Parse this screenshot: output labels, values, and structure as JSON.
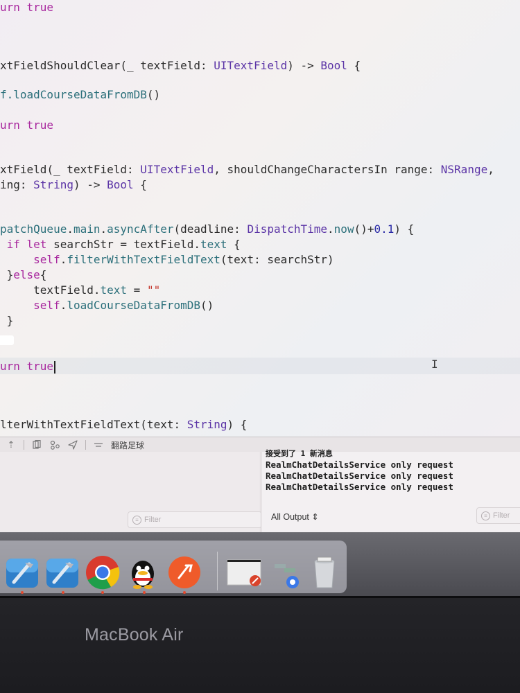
{
  "editor": {
    "lines": [
      [
        {
          "t": "urn ",
          "c": "kw"
        },
        {
          "t": "true",
          "c": "kw"
        }
      ],
      [
        {
          "t": "xtFieldShouldClear",
          "c": ""
        },
        {
          "t": "(_ textField: ",
          "c": ""
        },
        {
          "t": "UITextField",
          "c": "type"
        },
        {
          "t": ") -> ",
          "c": ""
        },
        {
          "t": "Bool",
          "c": "type"
        },
        {
          "t": " {",
          "c": ""
        }
      ],
      [
        {
          "t": "f.",
          "c": "fn"
        },
        {
          "t": "loadCourseDataFromDB",
          "c": "fn"
        },
        {
          "t": "()",
          "c": ""
        }
      ],
      [
        {
          "t": "urn ",
          "c": "kw"
        },
        {
          "t": "true",
          "c": "kw"
        }
      ],
      [
        {
          "t": "xtField",
          "c": ""
        },
        {
          "t": "(_ textField: ",
          "c": ""
        },
        {
          "t": "UITextField",
          "c": "type"
        },
        {
          "t": ", shouldChangeCharactersIn range: ",
          "c": ""
        },
        {
          "t": "NSRange",
          "c": "type"
        },
        {
          "t": ",",
          "c": ""
        }
      ],
      [
        {
          "t": "ing: ",
          "c": ""
        },
        {
          "t": "String",
          "c": "type"
        },
        {
          "t": ") -> ",
          "c": ""
        },
        {
          "t": "Bool",
          "c": "type"
        },
        {
          "t": " {",
          "c": ""
        }
      ],
      [
        {
          "t": "patchQueue",
          "c": "id"
        },
        {
          "t": ".",
          "c": ""
        },
        {
          "t": "main",
          "c": "id"
        },
        {
          "t": ".",
          "c": ""
        },
        {
          "t": "asyncAfter",
          "c": "id"
        },
        {
          "t": "(deadline: ",
          "c": ""
        },
        {
          "t": "DispatchTime",
          "c": "type"
        },
        {
          "t": ".",
          "c": ""
        },
        {
          "t": "now",
          "c": "id"
        },
        {
          "t": "()+",
          "c": ""
        },
        {
          "t": "0.1",
          "c": "num"
        },
        {
          "t": ") {",
          "c": ""
        }
      ],
      [
        {
          "t": " if ",
          "c": "kw"
        },
        {
          "t": "let ",
          "c": "kw"
        },
        {
          "t": "searchStr = textField.",
          "c": ""
        },
        {
          "t": "text",
          "c": "id"
        },
        {
          "t": " {",
          "c": ""
        }
      ],
      [
        {
          "t": "     self",
          "c": "kw"
        },
        {
          "t": ".",
          "c": ""
        },
        {
          "t": "filterWithTextFieldText",
          "c": "fn"
        },
        {
          "t": "(text: searchStr)",
          "c": ""
        }
      ],
      [
        {
          "t": " }",
          "c": ""
        },
        {
          "t": "else",
          "c": "kw"
        },
        {
          "t": "{",
          "c": ""
        }
      ],
      [
        {
          "t": "     textField.",
          "c": ""
        },
        {
          "t": "text",
          "c": "id"
        },
        {
          "t": " = ",
          "c": ""
        },
        {
          "t": "\"\"",
          "c": "str"
        }
      ],
      [
        {
          "t": "     self",
          "c": "kw"
        },
        {
          "t": ".",
          "c": ""
        },
        {
          "t": "loadCourseDataFromDB",
          "c": "fn"
        },
        {
          "t": "()",
          "c": ""
        }
      ],
      [
        {
          "t": " }",
          "c": ""
        }
      ],
      [
        {
          "t": "urn ",
          "c": "kw"
        },
        {
          "t": "true",
          "c": "kw"
        }
      ],
      [
        {
          "t": "lterWithTextFieldText",
          "c": ""
        },
        {
          "t": "(text: ",
          "c": ""
        },
        {
          "t": "String",
          "c": "type"
        },
        {
          "t": ") {",
          "c": ""
        }
      ]
    ]
  },
  "debug_bar": {
    "title": "翻路足球"
  },
  "variables": {
    "filter_placeholder": "Filter"
  },
  "console": {
    "lines": [
      "接受到了 1 新消息",
      "RealmChatDetailsService only request",
      "RealmChatDetailsService only request",
      "RealmChatDetailsService only request"
    ],
    "output_selector": "All Output",
    "filter_placeholder": "Filter"
  },
  "dock": {
    "apps": [
      {
        "icon": "xcode-icon"
      },
      {
        "icon": "xcode-icon"
      },
      {
        "icon": "chrome-icon"
      },
      {
        "icon": "qq-icon"
      },
      {
        "icon": "postman-icon"
      },
      {
        "icon": "document-stack-icon"
      },
      {
        "icon": "downloads-icon"
      },
      {
        "icon": "trash-icon"
      }
    ]
  },
  "bezel": {
    "brand": "MacBook Air"
  }
}
